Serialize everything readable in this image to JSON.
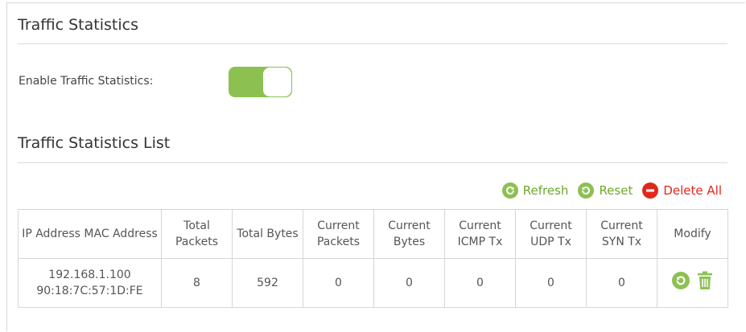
{
  "traffic": {
    "title": "Traffic Statistics",
    "enable_label": "Enable Traffic Statistics:",
    "enabled": true
  },
  "list": {
    "title": "Traffic Statistics List",
    "actions": {
      "refresh": "Refresh",
      "reset": "Reset",
      "delete_all": "Delete All"
    },
    "headers": {
      "ip_mac": "IP Address MAC Address",
      "total_packets": "Total Packets",
      "total_bytes": "Total Bytes",
      "current_packets": "Current Packets",
      "current_bytes": "Current Bytes",
      "current_icmp": "Current ICMP Tx",
      "current_udp": "Current UDP Tx",
      "current_syn": "Current SYN Tx",
      "modify": "Modify"
    },
    "rows": [
      {
        "ip_mac": "192.168.1.100 90:18:7C:57:1D:FE",
        "total_packets": "8",
        "total_bytes": "592",
        "current_packets": "0",
        "current_bytes": "0",
        "current_icmp": "0",
        "current_udp": "0",
        "current_syn": "0"
      }
    ]
  },
  "colors": {
    "accent_green": "#8cc152",
    "action_green_text": "#6fa82b",
    "danger_red": "#e0281c"
  },
  "icons": {
    "refresh": "refresh-icon",
    "reset": "reset-icon",
    "delete_all": "delete-all-icon",
    "row_reset": "row-reset-icon",
    "row_delete": "trash-icon"
  }
}
